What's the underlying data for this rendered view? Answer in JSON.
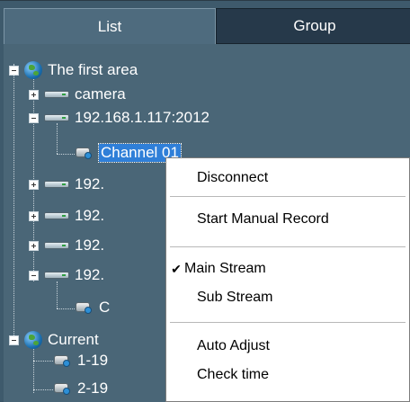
{
  "tabs": {
    "list": "List",
    "group": "Group"
  },
  "tree": {
    "area1": "The first area",
    "camera": "camera",
    "device_ip": "192.168.1.117:2012",
    "channel": "Channel 01",
    "dev2": "192.",
    "dev3": "192.",
    "dev4": "192.",
    "dev5": "192.",
    "sub_channel": "C",
    "area2": "Current",
    "cam_a": "1-19",
    "cam_b": "2-19"
  },
  "context_menu": {
    "disconnect": "Disconnect",
    "start_manual_record": "Start Manual Record",
    "main_stream": "Main Stream",
    "sub_stream": "Sub Stream",
    "auto_adjust": "Auto Adjust",
    "check_time": "Check time",
    "checked_item": "Main Stream",
    "check_mark": "✔"
  }
}
